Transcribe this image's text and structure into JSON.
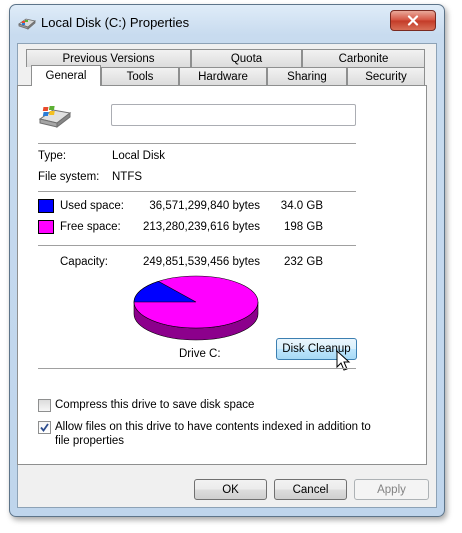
{
  "window": {
    "title": "Local Disk (C:) Properties"
  },
  "tabs_top": [
    "Previous Versions",
    "Quota",
    "Carbonite"
  ],
  "tabs_bottom": [
    "General",
    "Tools",
    "Hardware",
    "Sharing",
    "Security"
  ],
  "active_tab": "General",
  "general": {
    "drive_label_value": "",
    "type_label": "Type:",
    "type_value": "Local Disk",
    "fs_label": "File system:",
    "fs_value": "NTFS",
    "used_label": "Used space:",
    "used_bytes": "36,571,299,840 bytes",
    "used_gb": "34.0 GB",
    "free_label": "Free space:",
    "free_bytes": "213,280,239,616 bytes",
    "free_gb": "198 GB",
    "capacity_label": "Capacity:",
    "capacity_bytes": "249,851,539,456 bytes",
    "capacity_gb": "232 GB",
    "drive_caption": "Drive C:",
    "cleanup_button": "Disk Cleanup",
    "compress_label": "Compress this drive to save disk space",
    "compress_checked": false,
    "index_label": "Allow files on this drive to have contents indexed in addition to",
    "index_label_2": "file properties",
    "index_checked": true
  },
  "colors": {
    "used": "#0000ff",
    "free": "#ff00ff"
  },
  "pie": {
    "used_fraction": 0.1464,
    "free_fraction": 0.8536
  },
  "footer": {
    "ok": "OK",
    "cancel": "Cancel",
    "apply": "Apply"
  }
}
